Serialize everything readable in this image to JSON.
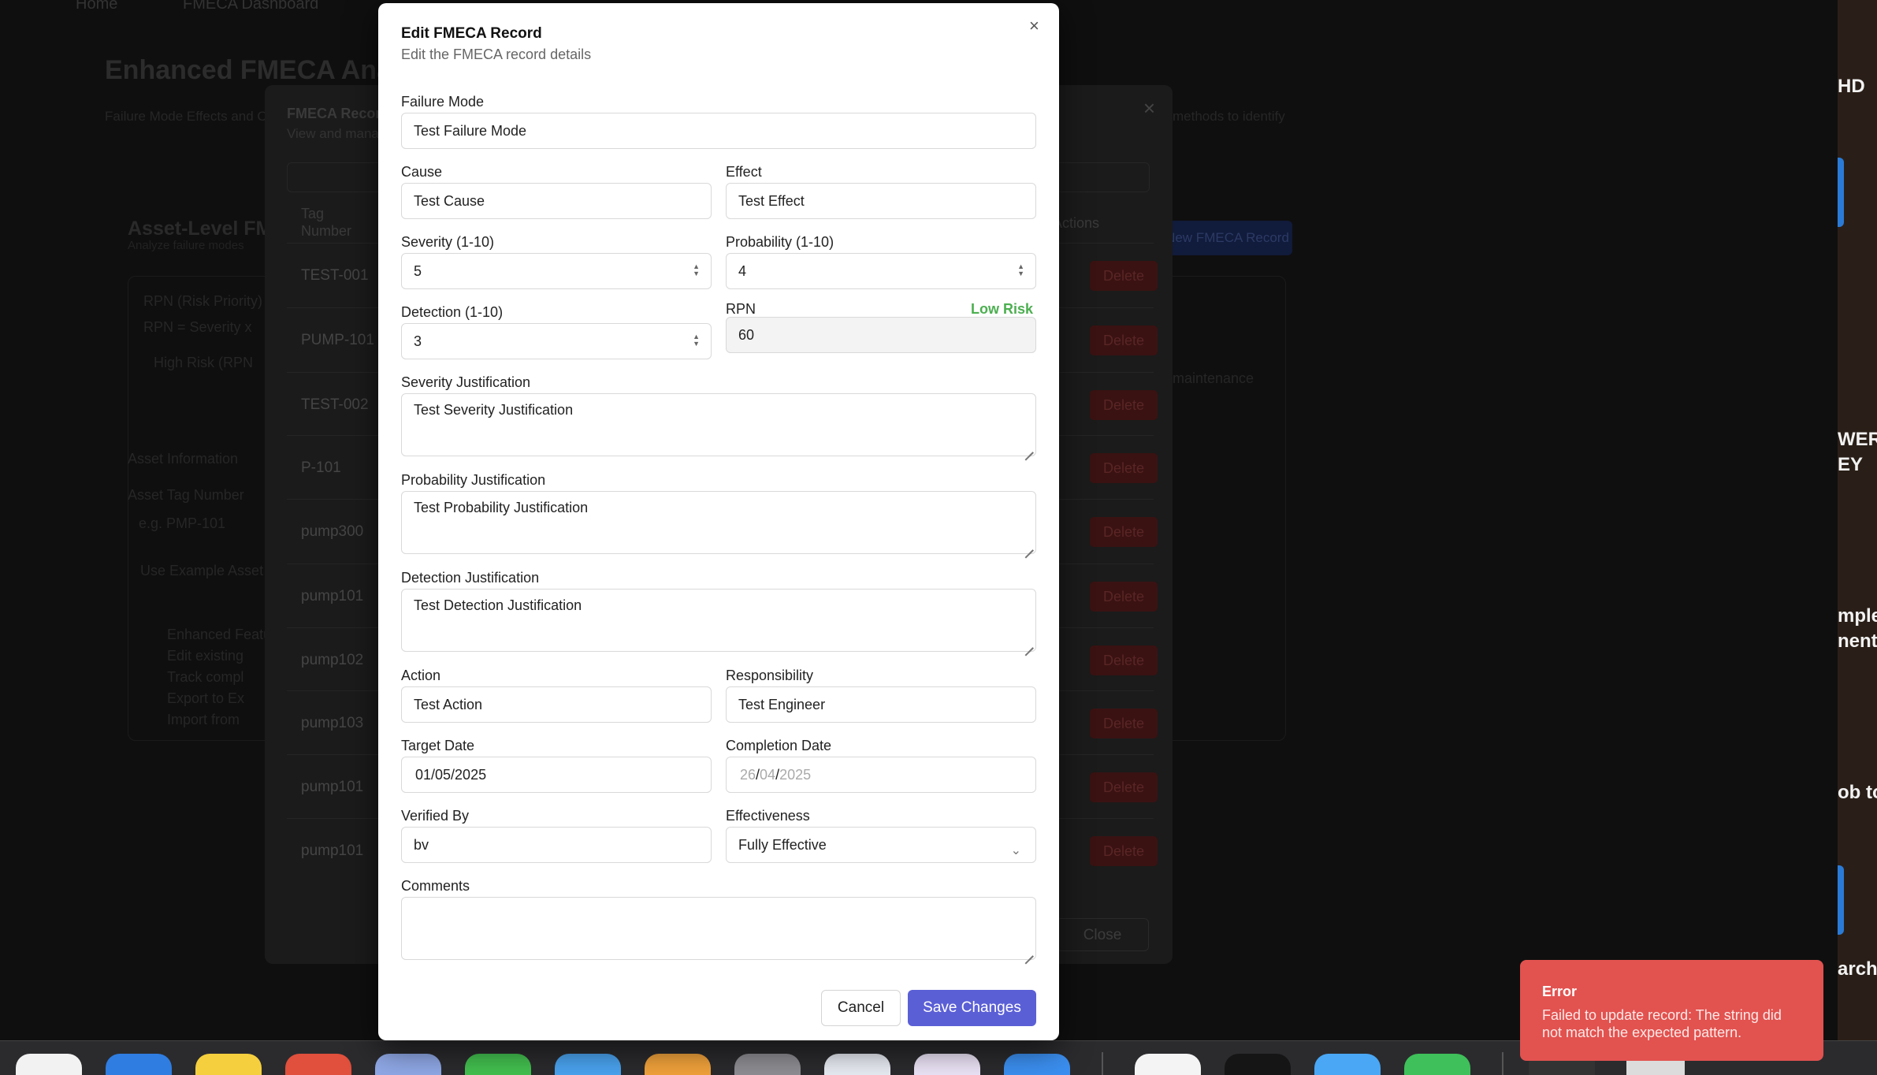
{
  "background": {
    "nav": [
      "Home",
      "FMECA Dashboard"
    ],
    "title": "Enhanced FMECA Analysis",
    "subtitle": "Failure Mode Effects and Criticality Analysis",
    "subtitle_right": "methods to identify",
    "section_title": "Asset-Level FMECA",
    "section_sub": "Analyze failure modes",
    "new_button": "New FMECA Record",
    "rpn_heading": "RPN (Risk Priority)",
    "rpn_formula": "RPN = Severity x",
    "high_risk": "High Risk (RPN",
    "asset_info": "Asset Information",
    "asset_tag_label": "Asset Tag Number",
    "asset_tag_placeholder": "e.g. PMP-101",
    "use_example": "Use Example Asset",
    "enhanced_features": "Enhanced Features",
    "features": [
      "Edit existing",
      "Track compl",
      "Export to Ex",
      "Import from"
    ],
    "maintenance": "maintenance",
    "records_modal": {
      "title": "FMECA Records",
      "subtitle": "View and manage",
      "col_tag": "Tag Number",
      "col_actions": "Actions",
      "rows": [
        "TEST-001",
        "PUMP-101",
        "TEST-002",
        "P-101",
        "pump300",
        "pump101",
        "pump102",
        "pump103",
        "pump101",
        "pump101"
      ],
      "delete_label": "Delete",
      "close_label": "Close"
    },
    "right_edge_texts": [
      "HD",
      "WER",
      "EY",
      "mple",
      "nents",
      "ob to",
      "arch"
    ]
  },
  "modal": {
    "title": "Edit FMECA Record",
    "description": "Edit the FMECA record details",
    "close_glyph": "×",
    "fields": {
      "failure_mode": {
        "label": "Failure Mode",
        "value": "Test Failure Mode"
      },
      "cause": {
        "label": "Cause",
        "value": "Test Cause"
      },
      "effect": {
        "label": "Effect",
        "value": "Test Effect"
      },
      "severity": {
        "label": "Severity (1-10)",
        "value": "5"
      },
      "probability": {
        "label": "Probability (1-10)",
        "value": "4"
      },
      "detection": {
        "label": "Detection (1-10)",
        "value": "3"
      },
      "rpn": {
        "label": "RPN",
        "value": "60",
        "risk_label": "Low Risk"
      },
      "severity_justification": {
        "label": "Severity Justification",
        "value": "Test Severity Justification"
      },
      "probability_justification": {
        "label": "Probability Justification",
        "value": "Test Probability Justification"
      },
      "detection_justification": {
        "label": "Detection Justification",
        "value": "Test Detection Justification"
      },
      "action": {
        "label": "Action",
        "value": "Test Action"
      },
      "responsibility": {
        "label": "Responsibility",
        "value": "Test Engineer"
      },
      "target_date": {
        "label": "Target Date",
        "value": "01/05/2025"
      },
      "completion_date": {
        "label": "Completion Date",
        "day": "26",
        "month": "04",
        "year": "2025",
        "sep": "/"
      },
      "verified_by": {
        "label": "Verified By",
        "value": "bv"
      },
      "effectiveness": {
        "label": "Effectiveness",
        "value": "Fully Effective"
      },
      "comments": {
        "label": "Comments",
        "value": ""
      }
    },
    "cancel_label": "Cancel",
    "save_label": "Save Changes"
  },
  "toast": {
    "title": "Error",
    "message": "Failed to update record: The string did not match the expected pattern."
  },
  "colors": {
    "primary": "#5b5fd6",
    "error": "#e2524f",
    "low_risk": "#4caf50"
  }
}
